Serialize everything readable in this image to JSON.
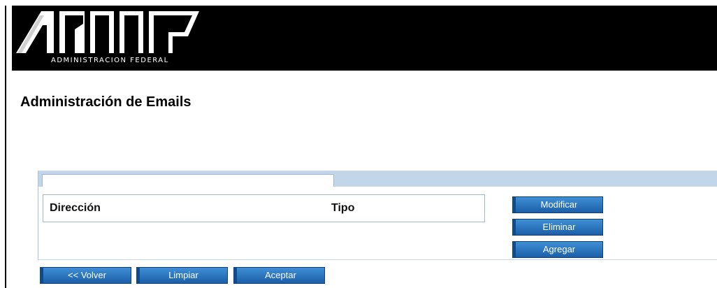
{
  "header": {
    "logo_text": "AFIP",
    "subtitle": "ADMINISTRACION FEDERAL",
    "background_color": "#000000"
  },
  "page": {
    "title": "Administración de Emails"
  },
  "panel": {
    "columns": {
      "direccion": "Dirección",
      "tipo": "Tipo"
    },
    "rows": []
  },
  "side_actions": {
    "modificar": "Modificar",
    "eliminar": "Eliminar",
    "agregar": "Agregar"
  },
  "bottom_actions": {
    "volver": "<< Volver",
    "limpiar": "Limpiar",
    "aceptar": "Aceptar"
  },
  "colors": {
    "button": "#2b74c2",
    "panel_tab": "#c3d5e9",
    "border": "#9fb7d1"
  }
}
